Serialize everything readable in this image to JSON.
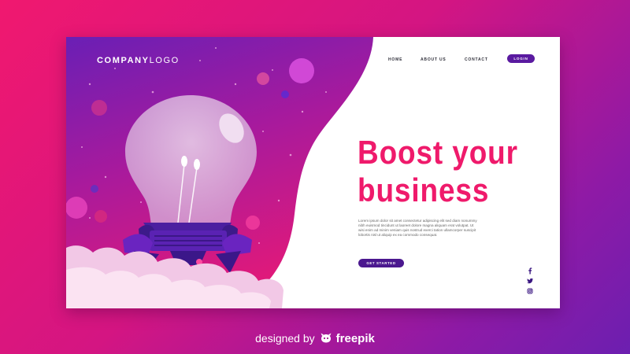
{
  "logo": {
    "strong": "COMPANY",
    "light": "LOGO"
  },
  "nav": {
    "items": [
      {
        "label": "HOME"
      },
      {
        "label": "ABOUT US"
      },
      {
        "label": "CONTACT"
      }
    ],
    "login_label": "LOGIN"
  },
  "hero": {
    "headline_line1": "Boost your",
    "headline_line2": "business",
    "body": "Lorem ipsum dolor sit amet consectetur adipiscing elit sed diam nonummy nibh euismod tincidunt ut laoreet dolore magna aliquam erat volutpat. Ut wisi enim ad minim veniam quis nostrud exerci tation ullamcorper suscipit lobortis nisl ut aliquip ex ea commodo consequat.",
    "cta_label": "GET STARTED"
  },
  "social": [
    "facebook-icon",
    "twitter-icon",
    "instagram-icon"
  ],
  "credit": {
    "prefix": "designed by",
    "brand": "freepik"
  },
  "colors": {
    "background_start": "#f0186f",
    "background_end": "#6c1fb0",
    "headline": "#ef1a6b",
    "button": "#5a1aa0",
    "hero_purple": "#6a1fb5",
    "hero_pink": "#e0197a"
  }
}
